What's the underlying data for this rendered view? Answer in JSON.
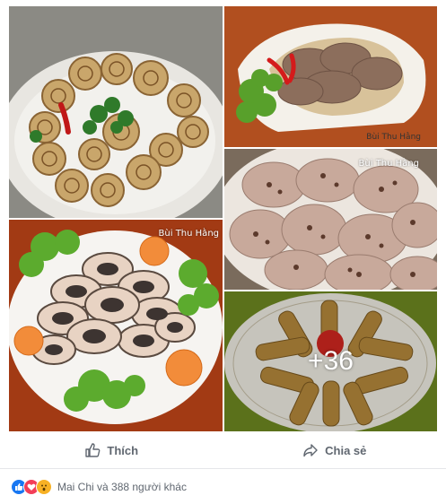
{
  "photos": {
    "watermark": "Bùi Thu Hằng",
    "more_count": "+36"
  },
  "actions": {
    "like_label": "Thích",
    "share_label": "Chia sẻ"
  },
  "reactions": {
    "icons": [
      "like-icon",
      "love-icon",
      "wow-icon"
    ],
    "summary": "Mai Chi và 388 người khác",
    "colors": {
      "like": "#1877f2",
      "love": "#f33e58",
      "wow": "#f7b125"
    }
  }
}
